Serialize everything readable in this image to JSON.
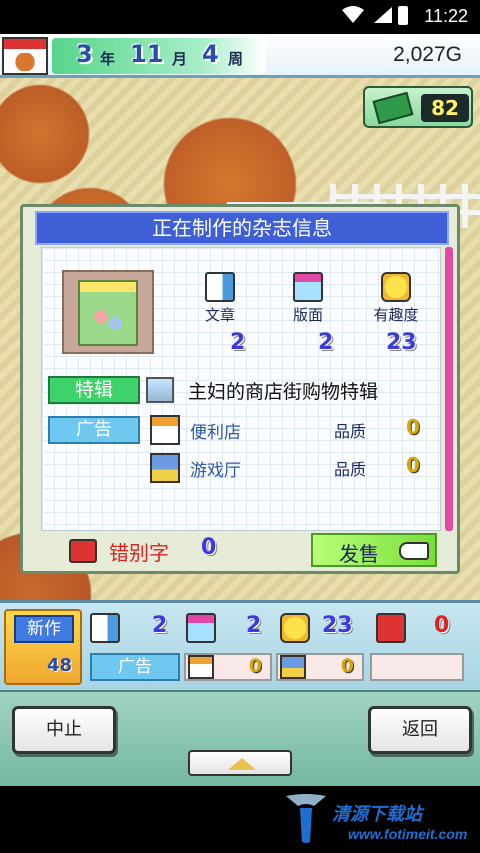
{
  "status_bar": {
    "time": "11:22"
  },
  "top_bar": {
    "year": "3",
    "year_unit": "年",
    "month": "11",
    "month_unit": "月",
    "week": "4",
    "week_unit": "周",
    "money": "2,027G"
  },
  "book_badge": {
    "count": "82"
  },
  "dialog": {
    "title": "正在制作的杂志信息",
    "stats": [
      {
        "label": "文章",
        "value": "2"
      },
      {
        "label": "版面",
        "value": "2"
      },
      {
        "label": "有趣度",
        "value": "23"
      }
    ],
    "feature": {
      "tag": "特辑",
      "text": "主妇的商店街购物特辑"
    },
    "ads": {
      "tag": "广告",
      "items": [
        {
          "name": "便利店",
          "quality_label": "品质",
          "quality": "0"
        },
        {
          "name": "游戏厅",
          "quality_label": "品质",
          "quality": "0"
        }
      ]
    },
    "typo_label": "错别字",
    "typo_value": "0",
    "sell_label": "发售"
  },
  "panel": {
    "new_tag": "新作",
    "new_count": "48",
    "stats": {
      "article": "2",
      "layout": "2",
      "fun": "23",
      "typo": "0"
    },
    "ad_tag": "广告",
    "ad_values": [
      "0",
      "0"
    ]
  },
  "buttons": {
    "stop": "中止",
    "back": "返回"
  },
  "watermark": {
    "name": "清源下载站",
    "url": "www.fotimeit.com"
  },
  "colors": {
    "dialog_title_bg": "#3e5fd6",
    "feature_tag": "#3dd26a",
    "ad_tag": "#6ec8f0",
    "value_blue": "#3a3adf",
    "quality_gold": "#d8a800",
    "typo_red": "#d22"
  }
}
